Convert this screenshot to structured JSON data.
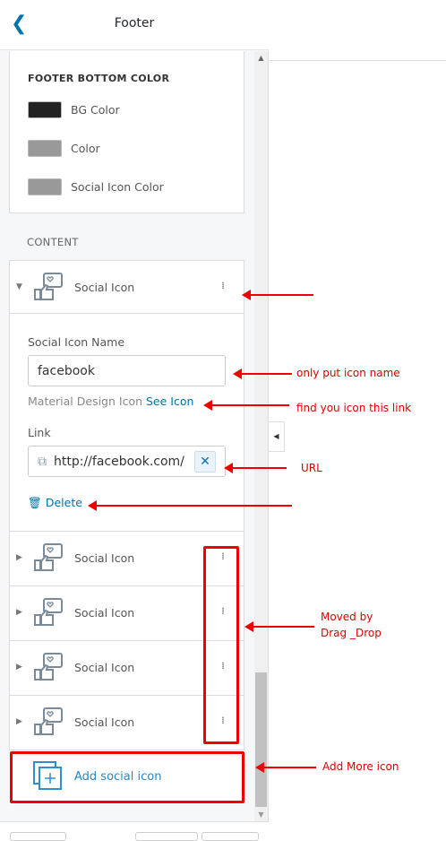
{
  "header": {
    "title": "Footer",
    "back_icon": "chevron-left-icon"
  },
  "footer_bottom_color": {
    "heading": "FOOTER BOTTOM COLOR",
    "items": [
      {
        "label": "BG Color",
        "color": "#222222"
      },
      {
        "label": "Color",
        "color": "#999999"
      },
      {
        "label": "Social Icon Color",
        "color": "#999999"
      }
    ]
  },
  "content": {
    "heading": "CONTENT",
    "expanded": {
      "title": "Social Icon",
      "name_label": "Social Icon Name",
      "name_value": "facebook",
      "help_text": "Material Design Icon",
      "help_link": "See Icon",
      "link_label": "Link",
      "link_value": "http://facebook.com/",
      "delete_label": "Delete"
    },
    "items": [
      {
        "title": "Social Icon"
      },
      {
        "title": "Social Icon"
      },
      {
        "title": "Social Icon"
      },
      {
        "title": "Social Icon"
      }
    ],
    "add_label": "Add social icon"
  },
  "annotations": {
    "drag": "",
    "name": "only put icon name",
    "see_icon": "find you icon this link",
    "url": "URL",
    "moved": "Moved by\nDrag _Drop",
    "add_more": "Add More icon"
  },
  "colors": {
    "accent": "#0073aa",
    "annotation": "#e00000"
  }
}
